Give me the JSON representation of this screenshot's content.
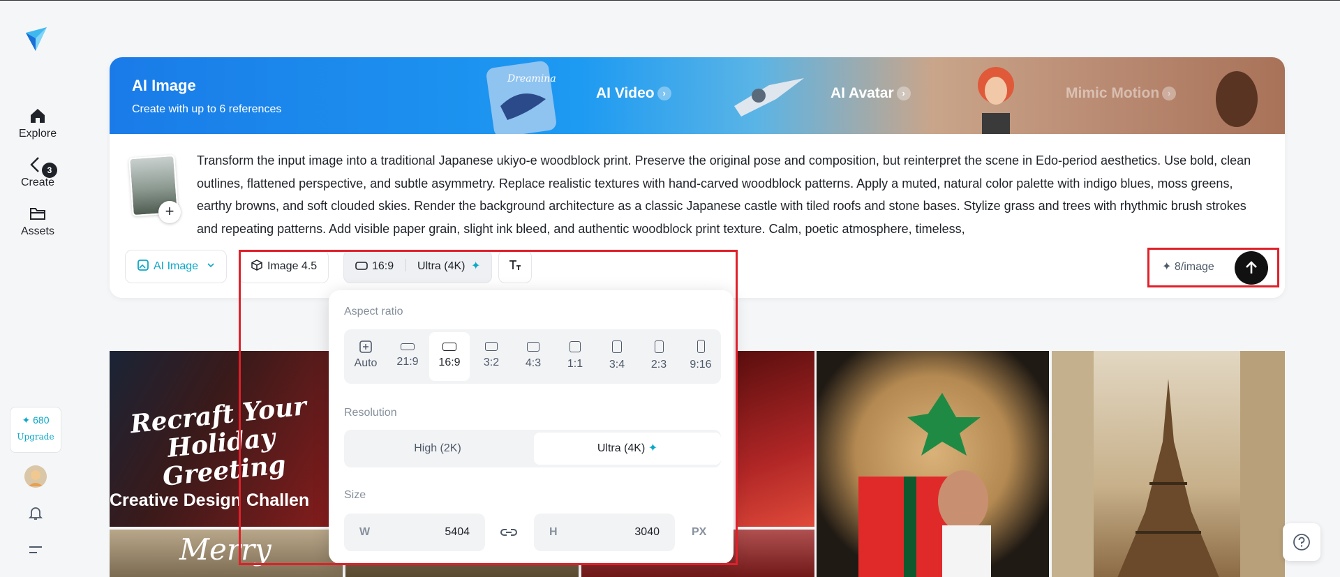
{
  "sidebar": {
    "explore": "Explore",
    "create": "Create",
    "create_badge": "3",
    "assets": "Assets",
    "credits": "✦ 680",
    "upgrade": "Upgrade"
  },
  "banner": {
    "title": "AI Image",
    "subtitle": "Create with up to 6 references",
    "links": [
      "AI Video",
      "AI Avatar",
      "Mimic Motion"
    ],
    "video_img_text": "Dreamina"
  },
  "prompt": {
    "text": "Transform the input image into a traditional Japanese ukiyo-e woodblock print. Preserve the original pose and composition, but reinterpret the scene in Edo-period aesthetics. Use bold, clean outlines, flattened perspective, and subtle asymmetry. Replace realistic textures with hand-carved woodblock patterns. Apply a muted, natural color palette with indigo blues, moss greens, earthy browns, and soft clouded skies. Render the background architecture as a classic Japanese castle with tiled roofs and stone bases. Stylize grass and trees with rhythmic brush strokes and repeating patterns. Add visible paper grain, slight ink bleed, and authentic woodblock print texture. Calm, poetic atmosphere, timeless,",
    "add_symbol": "+"
  },
  "toolbar": {
    "mode": "AI Image",
    "model": "Image 4.5",
    "ratio": "16:9",
    "resolution": "Ultra (4K)",
    "cost": "✦ 8/image"
  },
  "panel": {
    "aspect_label": "Aspect ratio",
    "ratios": [
      "Auto",
      "21:9",
      "16:9",
      "3:2",
      "4:3",
      "1:1",
      "3:4",
      "2:3",
      "9:16"
    ],
    "selected_ratio": "16:9",
    "resolution_label": "Resolution",
    "res_high": "High (2K)",
    "res_ultra": "Ultra (4K)",
    "size_label": "Size",
    "w_key": "W",
    "w_val": "5404",
    "h_key": "H",
    "h_val": "3040",
    "unit": "PX"
  },
  "gallery": {
    "card1_title": "Recraft Your Holiday Greeting",
    "card1_banner": "Creative Design Challen",
    "card2_title": "Merry"
  },
  "colors": {
    "accent": "#0aa7c7",
    "highlight": "#e0202a",
    "banner_blue": "#1a7be8"
  }
}
